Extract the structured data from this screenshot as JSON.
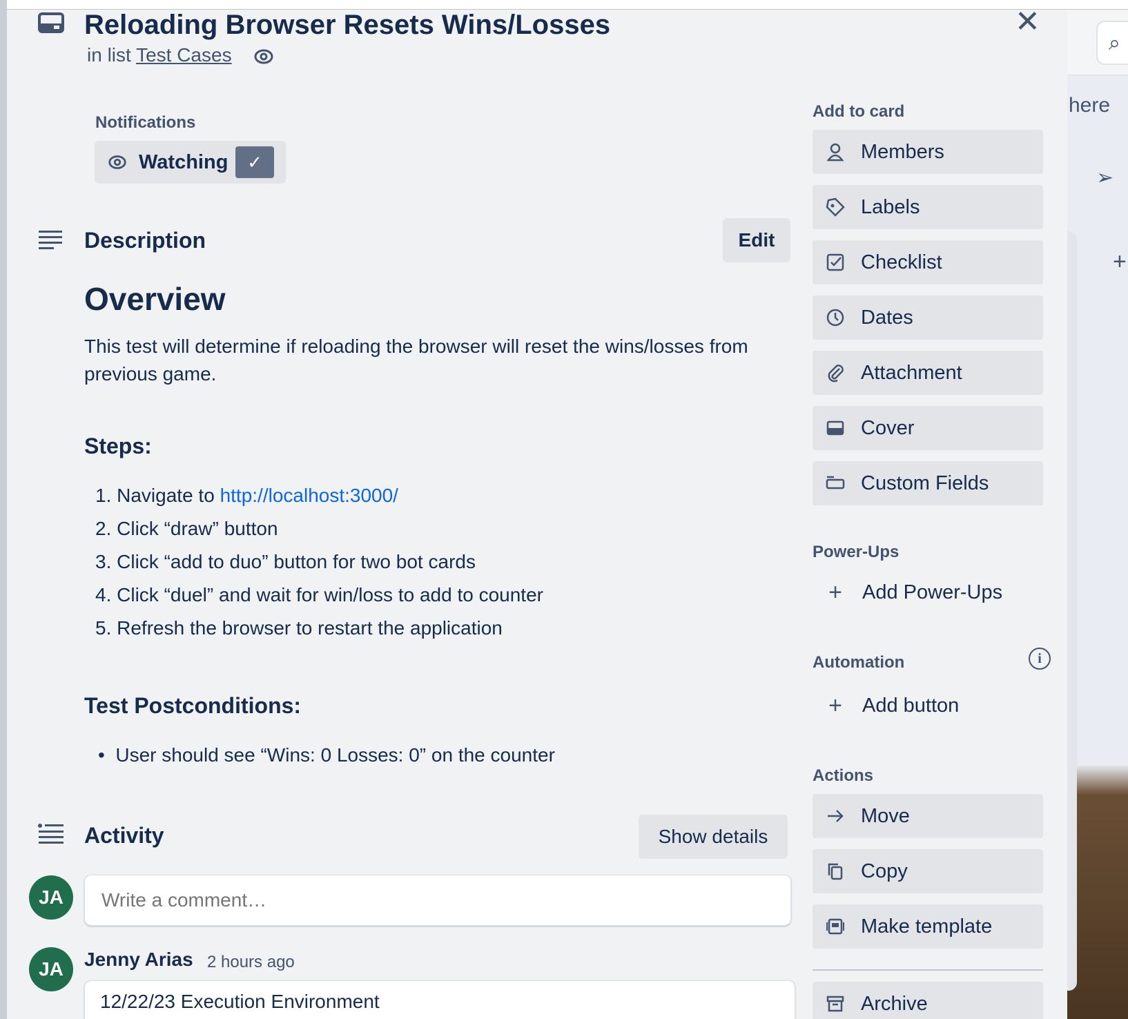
{
  "card": {
    "title": "Reloading Browser Resets Wins/Losses",
    "in_list_prefix": "in list",
    "list_name": "Test Cases"
  },
  "notifications": {
    "label": "Notifications",
    "watching_label": "Watching"
  },
  "description": {
    "heading": "Description",
    "edit_label": "Edit",
    "overview": "Overview",
    "paragraph": "This test will determine if reloading the browser will reset the wins/losses from previous game.",
    "steps_heading": "Steps:",
    "steps": [
      {
        "num": "1.",
        "text": "Navigate to ",
        "link": "http://localhost:3000/"
      },
      {
        "num": "2.",
        "text": "Click “draw” button"
      },
      {
        "num": "3.",
        "text": "Click “add to duo” button for two bot cards"
      },
      {
        "num": "4.",
        "text": "Click “duel” and wait for win/loss to add to counter"
      },
      {
        "num": "5.",
        "text": "Refresh the browser to restart the application"
      }
    ],
    "postconditions_heading": "Test Postconditions:",
    "postconditions": [
      "User should see “Wins: 0 Losses: 0” on the counter"
    ]
  },
  "activity": {
    "heading": "Activity",
    "show_details_label": "Show details",
    "comment_placeholder": "Write a comment…",
    "avatar_initials": "JA",
    "entries": [
      {
        "author": "Jenny Arias",
        "time": "2 hours ago",
        "text": "12/22/23 Execution Environment"
      }
    ]
  },
  "sidebar": {
    "add_to_card_heading": "Add to card",
    "add_to_card": [
      {
        "label": "Members",
        "icon": "person-icon"
      },
      {
        "label": "Labels",
        "icon": "tag-icon"
      },
      {
        "label": "Checklist",
        "icon": "checkbox-icon"
      },
      {
        "label": "Dates",
        "icon": "clock-icon"
      },
      {
        "label": "Attachment",
        "icon": "paperclip-icon"
      },
      {
        "label": "Cover",
        "icon": "cover-icon"
      },
      {
        "label": "Custom Fields",
        "icon": "custom-fields-icon"
      }
    ],
    "powerups_heading": "Power-Ups",
    "add_powerups_label": "Add Power-Ups",
    "automation_heading": "Automation",
    "add_button_label": "Add button",
    "actions_heading": "Actions",
    "actions": [
      {
        "label": "Move",
        "icon": "arrow-right-icon"
      },
      {
        "label": "Copy",
        "icon": "copy-icon"
      },
      {
        "label": "Make template",
        "icon": "template-icon"
      },
      {
        "label": "Archive",
        "icon": "archive-icon"
      }
    ]
  },
  "background": {
    "partial_text": "here"
  }
}
